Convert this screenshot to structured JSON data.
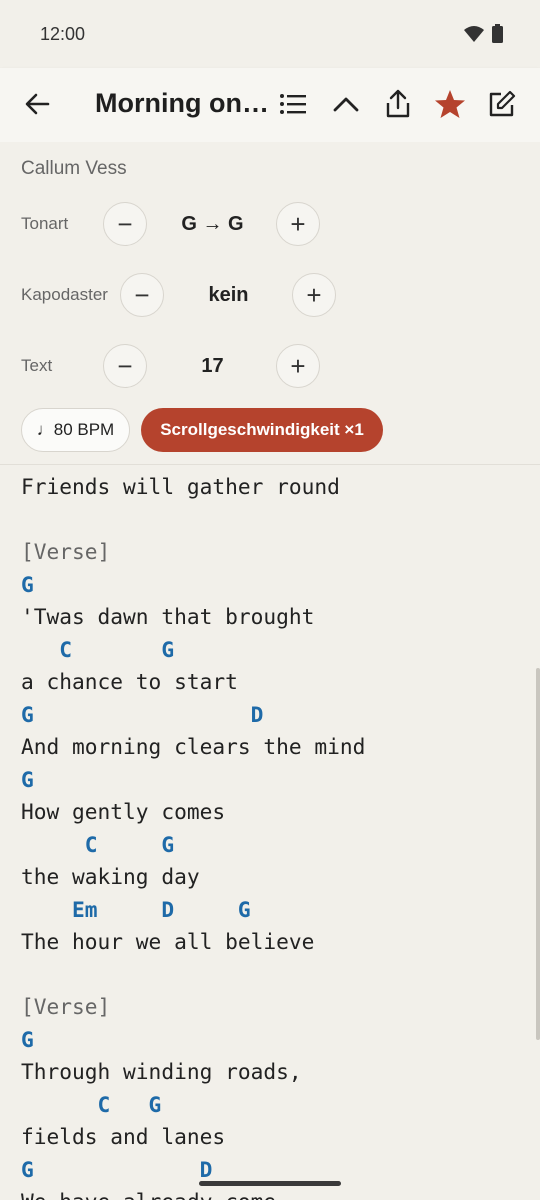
{
  "status": {
    "time": "12:00"
  },
  "appbar": {
    "title": "Morning on t…"
  },
  "icons": {
    "back": "arrow-back-icon",
    "list": "list-icon",
    "collapse": "chevron-up-icon",
    "share": "share-icon",
    "favorite": "star-icon",
    "edit": "edit-icon"
  },
  "colors": {
    "accent": "#b5432d",
    "chord": "#1e6aa8"
  },
  "song": {
    "author": "Callum Vess"
  },
  "controls": {
    "key": {
      "label": "Tonart",
      "value": "G → G"
    },
    "capo": {
      "label": "Kapodaster",
      "value": "kein"
    },
    "text": {
      "label": "Text",
      "value": "17"
    },
    "minus": "−",
    "plus": "+"
  },
  "pills": {
    "bpm": "♩80 BPM",
    "scroll": "Scrollgeschwindigkeit ×1"
  },
  "sheet": {
    "lines": [
      {
        "type": "lyric",
        "text": "Friends will gather round"
      },
      {
        "type": "blank",
        "text": ""
      },
      {
        "type": "section",
        "text": "[Verse]"
      },
      {
        "type": "chord",
        "text": "G"
      },
      {
        "type": "lyric",
        "text": "'Twas dawn that brought"
      },
      {
        "type": "chord",
        "text": "   C       G"
      },
      {
        "type": "lyric",
        "text": "a chance to start"
      },
      {
        "type": "chord",
        "text": "G                 D"
      },
      {
        "type": "lyric",
        "text": "And morning clears the mind"
      },
      {
        "type": "chord",
        "text": "G"
      },
      {
        "type": "lyric",
        "text": "How gently comes"
      },
      {
        "type": "chord",
        "text": "     C     G"
      },
      {
        "type": "lyric",
        "text": "the waking day"
      },
      {
        "type": "chord",
        "text": "    Em     D     G"
      },
      {
        "type": "lyric",
        "text": "The hour we all believe"
      },
      {
        "type": "blank",
        "text": ""
      },
      {
        "type": "section",
        "text": "[Verse]"
      },
      {
        "type": "chord",
        "text": "G"
      },
      {
        "type": "lyric",
        "text": "Through winding roads,"
      },
      {
        "type": "chord",
        "text": "      C   G"
      },
      {
        "type": "lyric",
        "text": "fields and lanes"
      },
      {
        "type": "chord",
        "text": "G             D"
      },
      {
        "type": "lyric",
        "text": "We have already come"
      }
    ]
  }
}
